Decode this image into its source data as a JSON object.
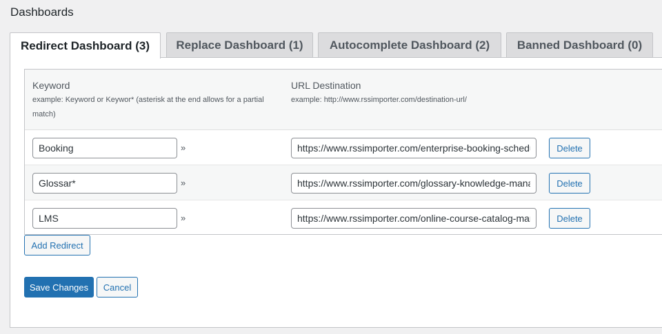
{
  "page": {
    "title": "Dashboards"
  },
  "tabs": [
    {
      "label": "Redirect Dashboard (3)",
      "active": true
    },
    {
      "label": "Replace Dashboard (1)",
      "active": false
    },
    {
      "label": "Autocomplete Dashboard (2)",
      "active": false
    },
    {
      "label": "Banned Dashboard (0)",
      "active": false
    }
  ],
  "table": {
    "keyword_header": "Keyword",
    "keyword_hint": "example: Keyword or Keywor* (asterisk at the end allows for a partial match)",
    "url_header": "URL Destination",
    "url_hint": "example: http://www.rssimporter.com/destination-url/",
    "separator": "»",
    "rows": [
      {
        "keyword": "Booking",
        "url": "https://www.rssimporter.com/enterprise-booking-scheduling-solution/",
        "delete_label": "Delete"
      },
      {
        "keyword": "Glossar*",
        "url": "https://www.rssimporter.com/glossary-knowledge-management/",
        "delete_label": "Delete"
      },
      {
        "keyword": "LMS",
        "url": "https://www.rssimporter.com/online-course-catalog-management/",
        "delete_label": "Delete"
      }
    ]
  },
  "actions": {
    "add_redirect": "Add Redirect",
    "save_changes": "Save Changes",
    "cancel": "Cancel"
  },
  "colors": {
    "accent": "#2271b1",
    "background": "#f0f0f1",
    "panel": "#ffffff",
    "tab_inactive": "#dcdcde",
    "border": "#c3c4c7"
  }
}
